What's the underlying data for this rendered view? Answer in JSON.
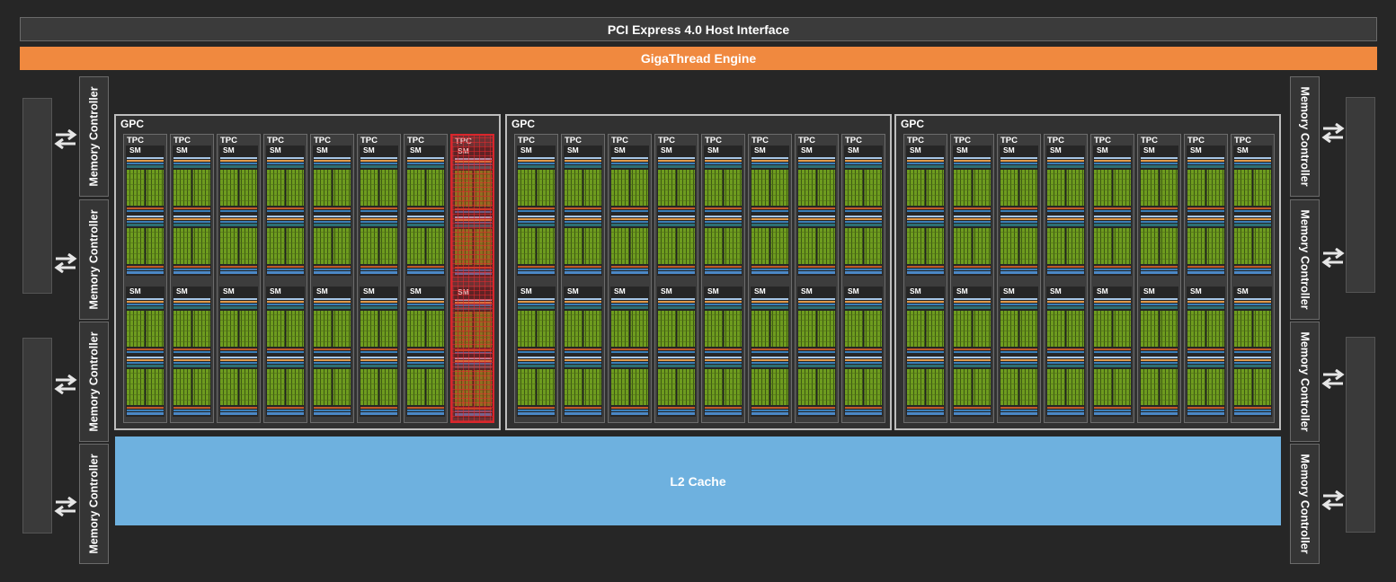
{
  "header": {
    "pcie_label": "PCI Express 4.0 Host Interface",
    "gigathread_label": "GigaThread Engine"
  },
  "memory_controller_label": "Memory Controller",
  "gpc_label": "GPC",
  "tpc_label": "TPC",
  "sm_label": "SM",
  "l2_label": "L2 Cache",
  "gpc_count": 3,
  "tpcs_per_gpc": 8,
  "sms_per_tpc": 2,
  "highlighted_tpc": {
    "gpc": 1,
    "tpc": 8
  },
  "colors": {
    "background": "#262626",
    "pcie": "#3b3b3b",
    "gigathread": "#f0893f",
    "l2_cache": "#6eb1df",
    "cuda_cores": "#6e9c1f",
    "highlight": "#d9262c"
  }
}
